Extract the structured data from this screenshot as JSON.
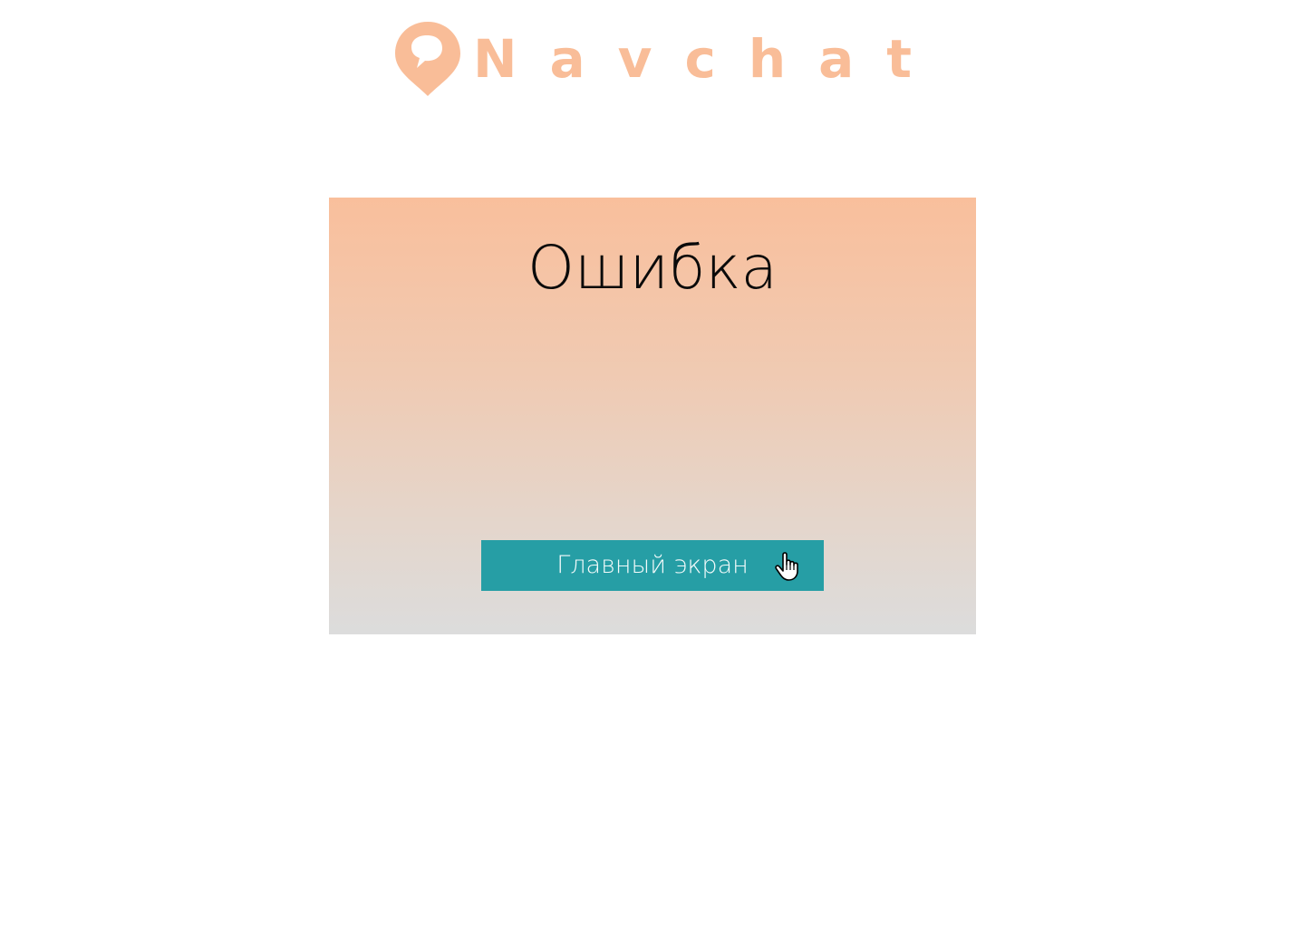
{
  "brand": {
    "name": "Navchat",
    "color": "#f9bd98",
    "icon": "chat-pin-icon"
  },
  "error_card": {
    "title": "Ошибка",
    "home_button_label": "Главный экран",
    "button_color": "#269ea5"
  },
  "cursor": {
    "icon": "hand-pointer-icon"
  }
}
